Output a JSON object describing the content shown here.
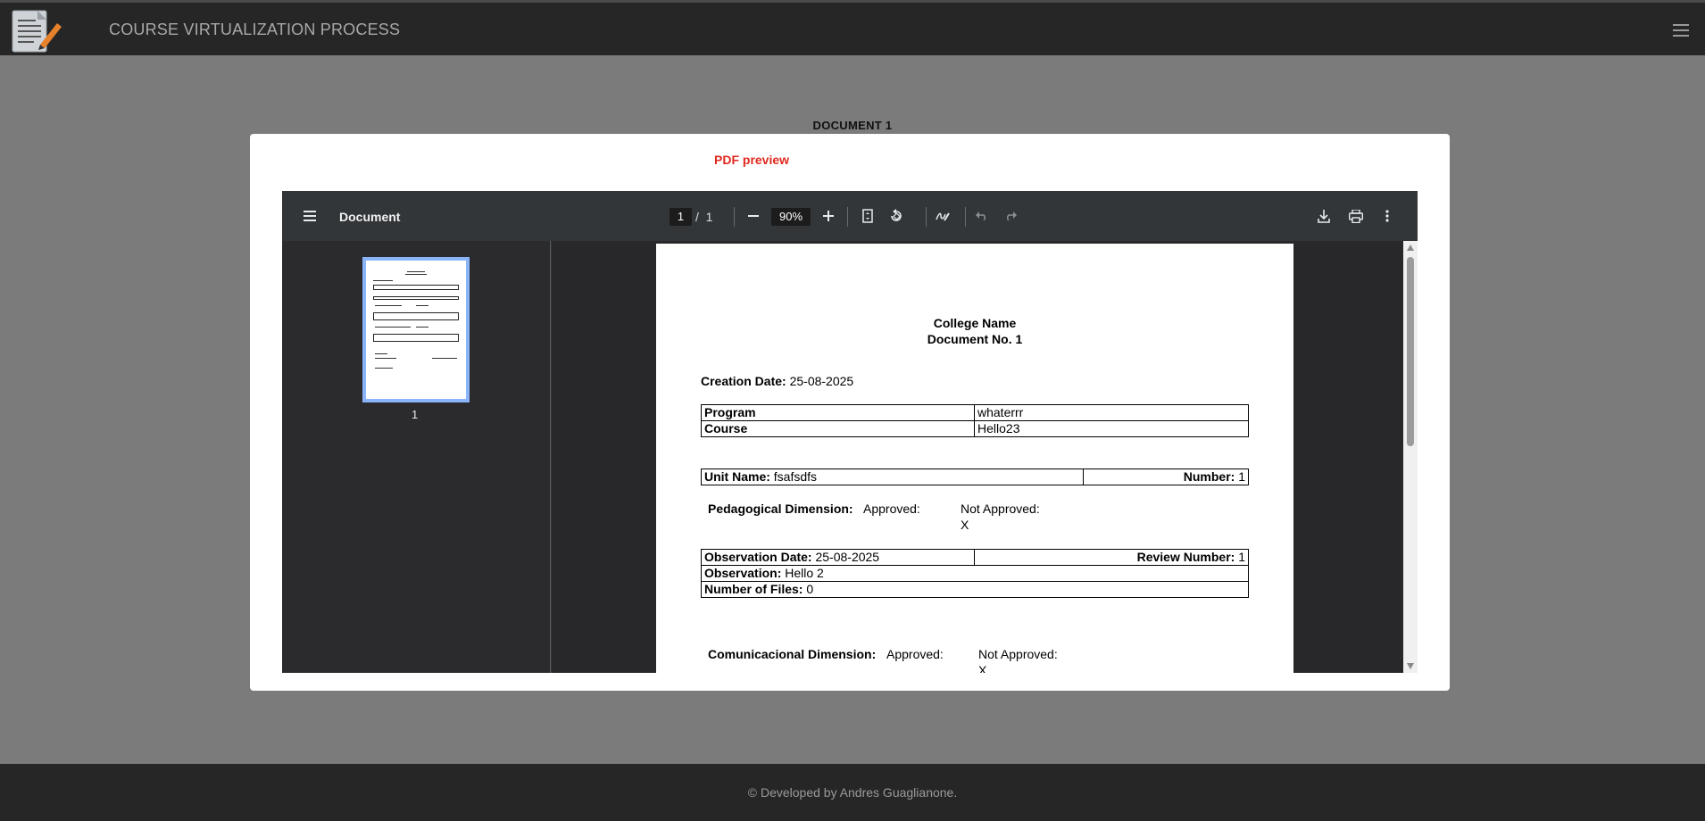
{
  "app": {
    "title": "COURSE VIRTUALIZATION PROCESS"
  },
  "document_heading": "DOCUMENT 1",
  "modal": {
    "preview_label": "PDF preview"
  },
  "viewer": {
    "doc_name": "Document",
    "current_page": "1",
    "page_separator": "/",
    "total_pages": "1",
    "zoom": "90%",
    "thumbnail_label": "1"
  },
  "pdf": {
    "college": "College Name",
    "doc_no": "Document No. 1",
    "creation_date_label": "Creation Date:",
    "creation_date": "25-08-2025",
    "program_label": "Program",
    "program_value": "whaterrr",
    "course_label": "Course",
    "course_value": "Hello23",
    "unit_name_label": "Unit Name:",
    "unit_name": "fsafsdfs",
    "number_label": "Number:",
    "number": "1",
    "pedagogical_label": "Pedagogical Dimension:",
    "approved_label": "Approved:",
    "not_approved_label": "Not Approved:",
    "pedagogical_mark": "X",
    "observation_date_label": "Observation Date:",
    "observation_date": "25-08-2025",
    "review_number_label": "Review Number:",
    "review_number": "1",
    "observation_label": "Observation:",
    "observation": "Hello 2",
    "files_label": "Number of Files:",
    "files": "0",
    "comunicacional_label": "Comunicacional Dimension:",
    "comunicacional_mark": "X"
  },
  "footer": {
    "text": "© Developed by Andres Guaglianone."
  }
}
